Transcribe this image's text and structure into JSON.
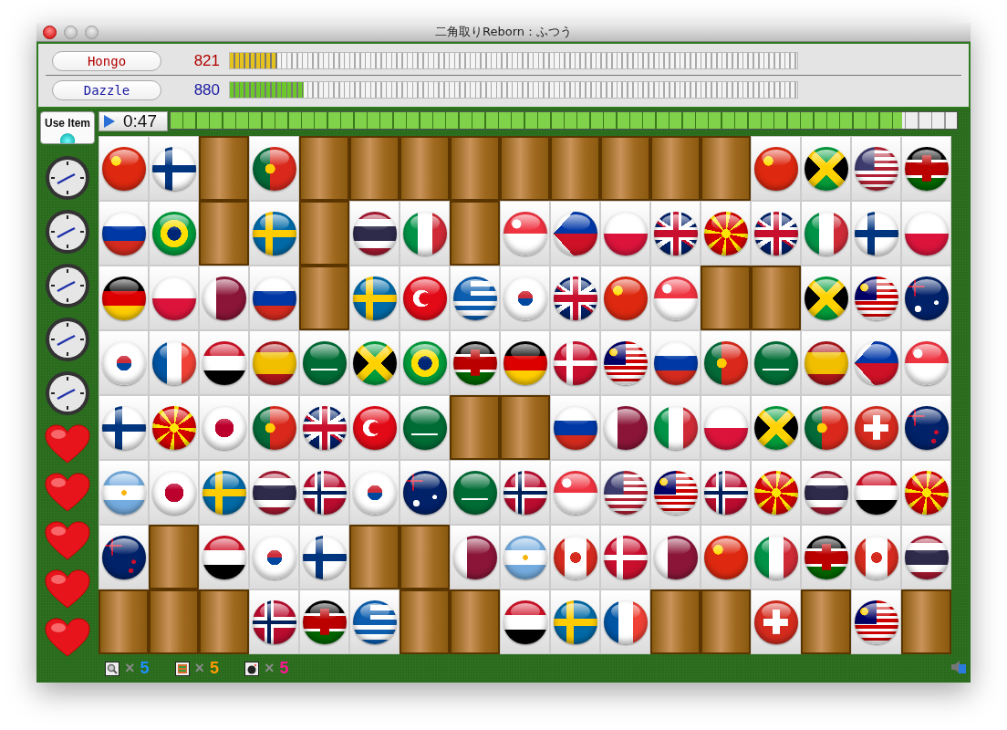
{
  "window": {
    "title": "二角取りReborn：ふつう"
  },
  "players": [
    {
      "name": "Hongo",
      "score": "821",
      "color": "#b00000",
      "bar": {
        "color": "#e6c21e",
        "level": 0.083
      }
    },
    {
      "name": "Dazzle",
      "score": "880",
      "color": "#1a1aa0",
      "bar": {
        "color": "#6cc82a",
        "level": 0.13
      }
    }
  ],
  "use_item_button": {
    "label": "Use Item"
  },
  "timer": {
    "time": "0:47",
    "level": 0.93
  },
  "side": [
    {
      "kind": "clock"
    },
    {
      "kind": "clock"
    },
    {
      "kind": "clock"
    },
    {
      "kind": "clock"
    },
    {
      "kind": "clock"
    },
    {
      "kind": "heart"
    },
    {
      "kind": "heart"
    },
    {
      "kind": "heart"
    },
    {
      "kind": "heart"
    },
    {
      "kind": "heart"
    }
  ],
  "board": {
    "rows": [
      {
        "tiles": [
          {
            "kind": "cn"
          },
          {
            "kind": "fi"
          },
          {
            "kind": "wood"
          },
          {
            "kind": "pt"
          },
          {
            "kind": "wood"
          },
          {
            "kind": "wood"
          },
          {
            "kind": "wood"
          },
          {
            "kind": "wood"
          },
          {
            "kind": "wood"
          },
          {
            "kind": "wood"
          },
          {
            "kind": "wood"
          },
          {
            "kind": "wood"
          },
          {
            "kind": "wood"
          },
          {
            "kind": "cn"
          },
          {
            "kind": "jm"
          },
          {
            "kind": "us"
          },
          {
            "kind": "ke"
          }
        ]
      },
      {
        "tiles": [
          {
            "kind": "ru"
          },
          {
            "kind": "br"
          },
          {
            "kind": "wood"
          },
          {
            "kind": "se"
          },
          {
            "kind": "wood"
          },
          {
            "kind": "th"
          },
          {
            "kind": "it"
          },
          {
            "kind": "wood"
          },
          {
            "kind": "sg"
          },
          {
            "kind": "ph"
          },
          {
            "kind": "pl"
          },
          {
            "kind": "gb"
          },
          {
            "kind": "mk"
          },
          {
            "kind": "gb"
          },
          {
            "kind": "it"
          },
          {
            "kind": "fi"
          },
          {
            "kind": "pl"
          }
        ]
      },
      {
        "tiles": [
          {
            "kind": "de"
          },
          {
            "kind": "pl"
          },
          {
            "kind": "qa"
          },
          {
            "kind": "ru"
          },
          {
            "kind": "wood"
          },
          {
            "kind": "se"
          },
          {
            "kind": "tr"
          },
          {
            "kind": "gr"
          },
          {
            "kind": "kr"
          },
          {
            "kind": "gb"
          },
          {
            "kind": "cn"
          },
          {
            "kind": "sg"
          },
          {
            "kind": "wood"
          },
          {
            "kind": "wood"
          },
          {
            "kind": "jm"
          },
          {
            "kind": "my"
          },
          {
            "kind": "au"
          }
        ]
      },
      {
        "tiles": [
          {
            "kind": "kr"
          },
          {
            "kind": "fr"
          },
          {
            "kind": "eg"
          },
          {
            "kind": "es"
          },
          {
            "kind": "sa"
          },
          {
            "kind": "jm"
          },
          {
            "kind": "br"
          },
          {
            "kind": "ke"
          },
          {
            "kind": "de"
          },
          {
            "kind": "dk"
          },
          {
            "kind": "my"
          },
          {
            "kind": "ru"
          },
          {
            "kind": "pt"
          },
          {
            "kind": "sa"
          },
          {
            "kind": "es"
          },
          {
            "kind": "ph"
          },
          {
            "kind": "sg"
          }
        ]
      },
      {
        "tiles": [
          {
            "kind": "fi"
          },
          {
            "kind": "mk"
          },
          {
            "kind": "jp"
          },
          {
            "kind": "pt"
          },
          {
            "kind": "gb"
          },
          {
            "kind": "tr"
          },
          {
            "kind": "sa"
          },
          {
            "kind": "wood"
          },
          {
            "kind": "wood"
          },
          {
            "kind": "ru"
          },
          {
            "kind": "qa"
          },
          {
            "kind": "it"
          },
          {
            "kind": "pl"
          },
          {
            "kind": "jm"
          },
          {
            "kind": "pt"
          },
          {
            "kind": "ch"
          },
          {
            "kind": "nz"
          }
        ]
      },
      {
        "tiles": [
          {
            "kind": "ar"
          },
          {
            "kind": "jp"
          },
          {
            "kind": "se"
          },
          {
            "kind": "th"
          },
          {
            "kind": "no"
          },
          {
            "kind": "kr"
          },
          {
            "kind": "au"
          },
          {
            "kind": "sa"
          },
          {
            "kind": "no"
          },
          {
            "kind": "sg"
          },
          {
            "kind": "us"
          },
          {
            "kind": "my"
          },
          {
            "kind": "no"
          },
          {
            "kind": "mk"
          },
          {
            "kind": "th"
          },
          {
            "kind": "eg"
          },
          {
            "kind": "mk"
          }
        ]
      },
      {
        "tiles": [
          {
            "kind": "nz"
          },
          {
            "kind": "wood"
          },
          {
            "kind": "eg"
          },
          {
            "kind": "kr"
          },
          {
            "kind": "fi"
          },
          {
            "kind": "wood"
          },
          {
            "kind": "wood"
          },
          {
            "kind": "qa"
          },
          {
            "kind": "ar"
          },
          {
            "kind": "ca"
          },
          {
            "kind": "dk"
          },
          {
            "kind": "qa"
          },
          {
            "kind": "cn"
          },
          {
            "kind": "it"
          },
          {
            "kind": "ke"
          },
          {
            "kind": "ca"
          },
          {
            "kind": "th"
          }
        ]
      },
      {
        "tiles": [
          {
            "kind": "wood"
          },
          {
            "kind": "wood"
          },
          {
            "kind": "wood"
          },
          {
            "kind": "no"
          },
          {
            "kind": "ke"
          },
          {
            "kind": "gr"
          },
          {
            "kind": "wood"
          },
          {
            "kind": "wood"
          },
          {
            "kind": "eg"
          },
          {
            "kind": "se"
          },
          {
            "kind": "fr"
          },
          {
            "kind": "wood"
          },
          {
            "kind": "wood"
          },
          {
            "kind": "ch"
          },
          {
            "kind": "wood"
          },
          {
            "kind": "my"
          },
          {
            "kind": "wood"
          }
        ]
      }
    ]
  },
  "items": [
    {
      "kind": "magnifier",
      "times": "×",
      "count": "5",
      "color": "#1e8fff"
    },
    {
      "kind": "swap",
      "times": "×",
      "count": "5",
      "color": "#ff9a00"
    },
    {
      "kind": "bomb",
      "times": "×",
      "count": "5",
      "color": "#ff1493"
    }
  ]
}
